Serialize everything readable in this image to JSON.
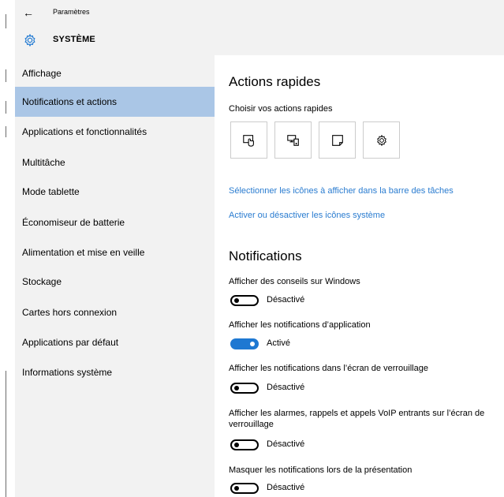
{
  "window": {
    "title": "Paramètres",
    "back_icon": "back-arrow-icon"
  },
  "header": {
    "title": "SYSTÈME",
    "icon": "gear-icon"
  },
  "sidebar": {
    "items": [
      {
        "label": "Affichage",
        "selected": false
      },
      {
        "label": "Notifications et actions",
        "selected": true
      },
      {
        "label": "Applications et fonctionnalités",
        "selected": false
      },
      {
        "label": "Multitâche",
        "selected": false
      },
      {
        "label": "Mode tablette",
        "selected": false
      },
      {
        "label": "Économiseur de batterie",
        "selected": false
      },
      {
        "label": "Alimentation et mise en veille",
        "selected": false
      },
      {
        "label": "Stockage",
        "selected": false
      },
      {
        "label": "Cartes hors connexion",
        "selected": false
      },
      {
        "label": "Applications par défaut",
        "selected": false
      },
      {
        "label": "Informations système",
        "selected": false
      }
    ]
  },
  "quick_actions": {
    "title": "Actions rapides",
    "subtitle": "Choisir vos actions rapides",
    "tiles": [
      {
        "icon": "tablet-mode-icon"
      },
      {
        "icon": "connect-display-icon"
      },
      {
        "icon": "note-icon"
      },
      {
        "icon": "settings-gear-icon"
      }
    ],
    "link_taskbar": "Sélectionner les icônes à afficher dans la barre des tâches",
    "link_system_icons": "Activer ou désactiver les icônes système"
  },
  "notifications": {
    "title": "Notifications",
    "settings": [
      {
        "label": "Afficher des conseils sur Windows",
        "state": "Désactivé",
        "on": false
      },
      {
        "label": "Afficher les notifications d’application",
        "state": "Activé",
        "on": true
      },
      {
        "label": "Afficher les notifications dans l’écran de verrouillage",
        "state": "Désactivé",
        "on": false
      },
      {
        "label": "Afficher les alarmes, rappels et appels VoIP entrants sur l’écran de verrouillage",
        "state": "Désactivé",
        "on": false
      },
      {
        "label": "Masquer les notifications lors de la présentation",
        "state": "Désactivé",
        "on": false
      }
    ]
  },
  "colors": {
    "accent": "#1e78d2",
    "link": "#2a7cd0",
    "selected_nav": "#aac6e6",
    "panel_bg": "#f2f2f2"
  }
}
